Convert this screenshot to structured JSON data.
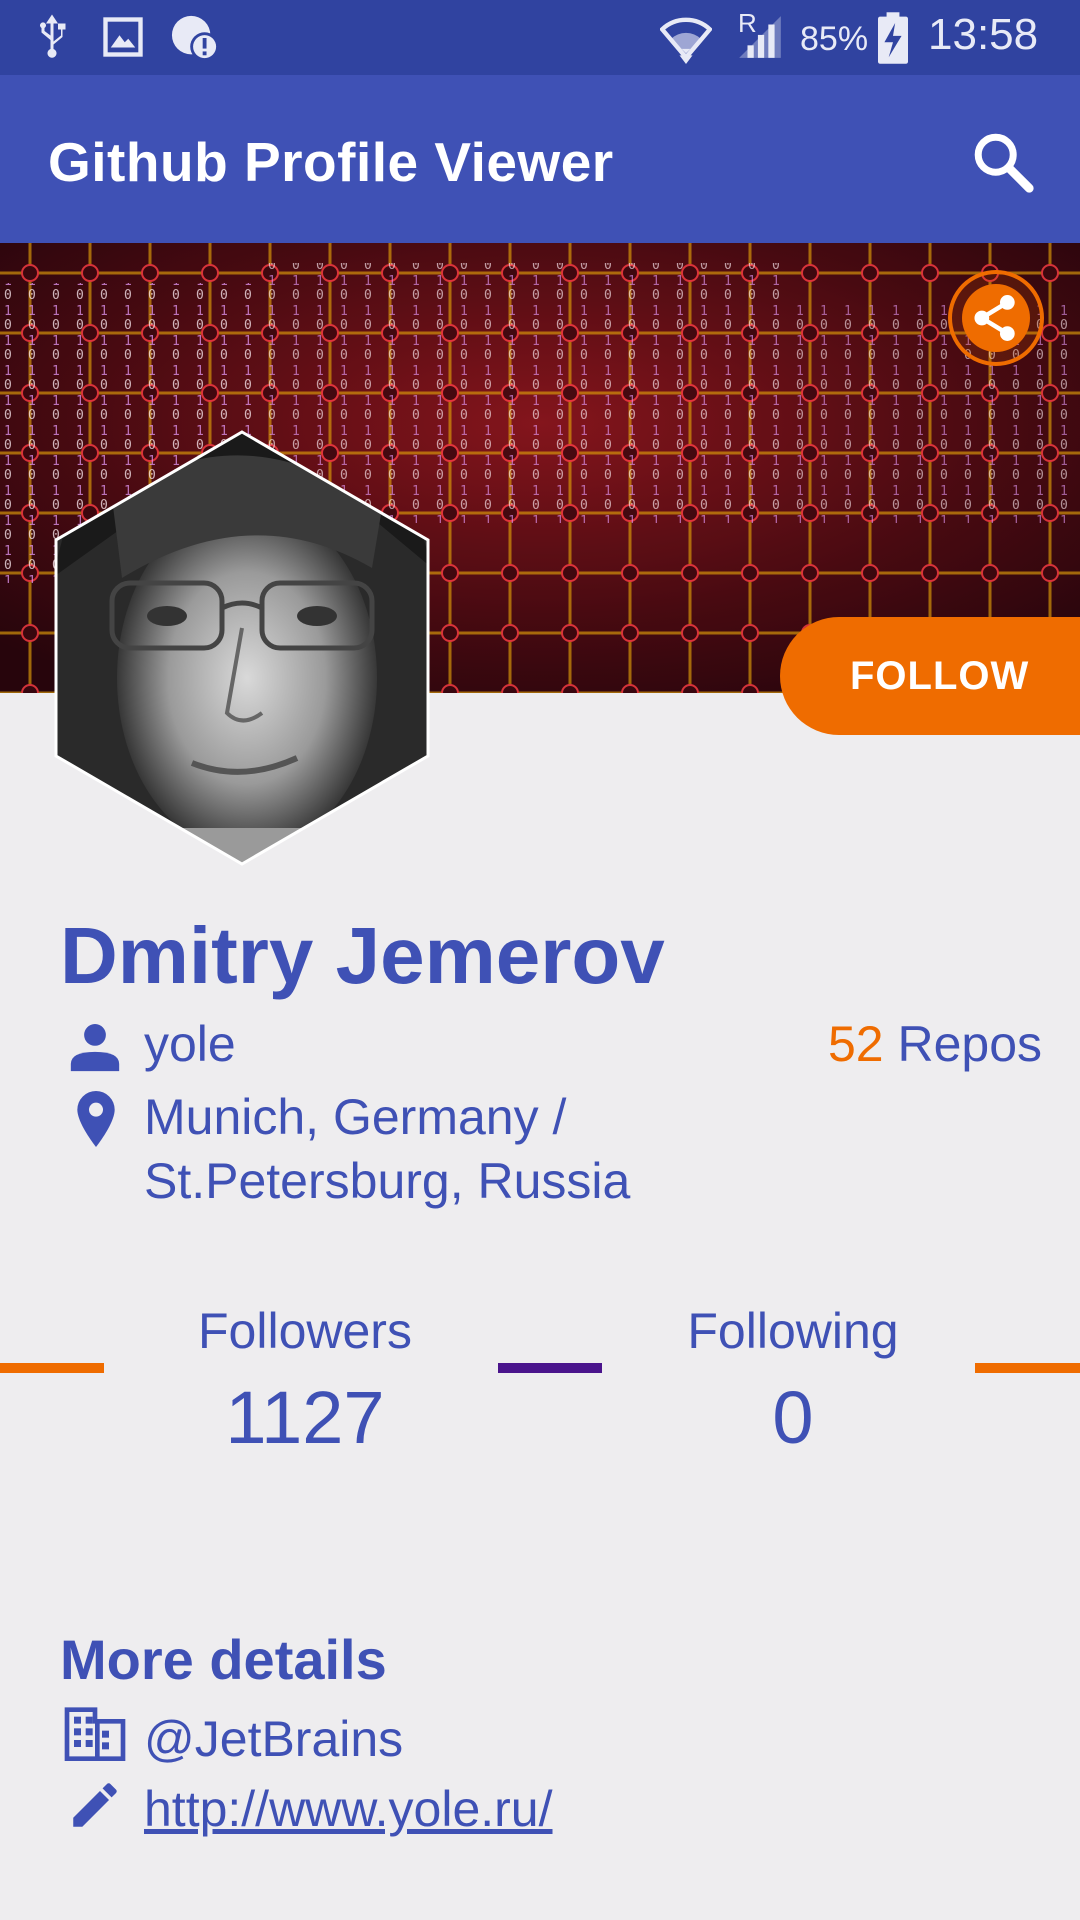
{
  "status_bar": {
    "time": "13:58",
    "battery": "85%",
    "signal_label": "R"
  },
  "app_bar": {
    "title": "Github Profile Viewer"
  },
  "profile": {
    "name": "Dmitry Jemerov",
    "username": "yole",
    "location_line1": "Munich, Germany /",
    "location_line2": "St.Petersburg, Russia",
    "repos_count": "52",
    "repos_label": "Repos",
    "follow_label": "FOLLOW"
  },
  "stats": {
    "followers_label": "Followers",
    "followers_value": "1127",
    "following_label": "Following",
    "following_value": "0"
  },
  "details": {
    "title": "More details",
    "company": "@JetBrains",
    "blog": "http://www.yole.ru/"
  },
  "colors": {
    "primary": "#3f51b5",
    "primary_dark": "#3043a0",
    "accent": "#ef6c00",
    "purple": "#4a148c",
    "background": "#eeedef"
  },
  "icons": [
    "usb-icon",
    "image-icon",
    "alert-icon",
    "wifi-icon",
    "signal-icon",
    "battery-icon",
    "search-icon",
    "share-icon",
    "person-icon",
    "location-icon",
    "business-icon",
    "edit-icon"
  ]
}
